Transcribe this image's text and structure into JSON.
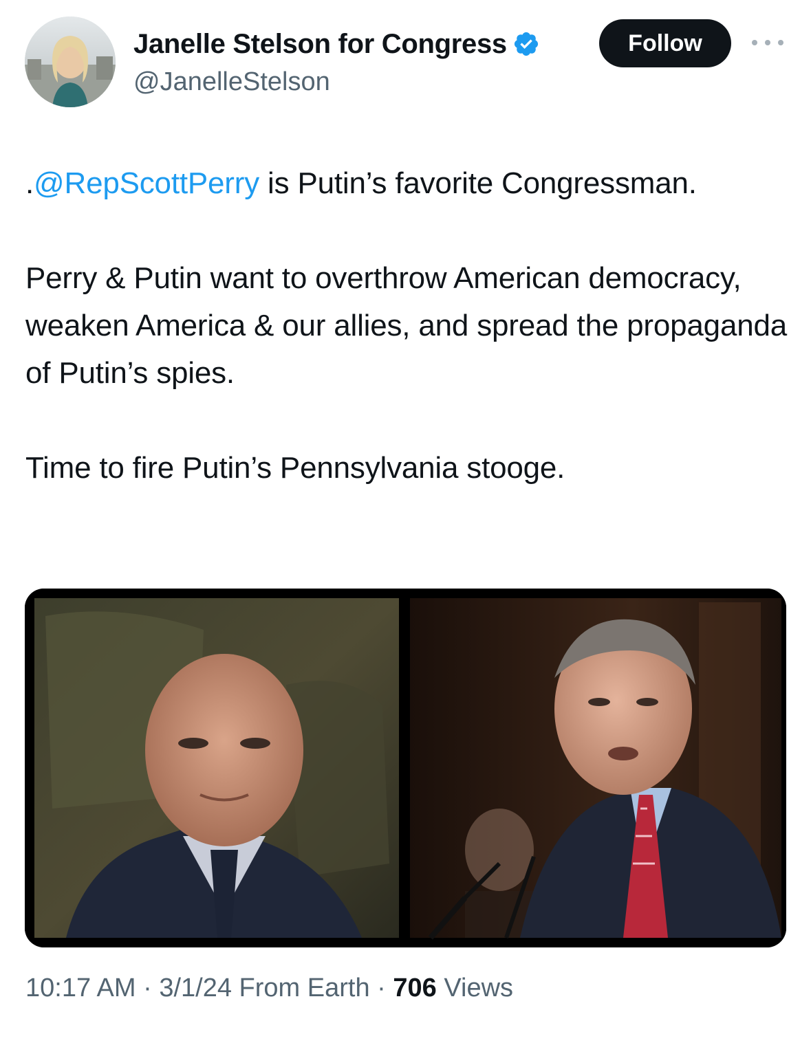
{
  "author": {
    "display_name": "Janelle Stelson for Congress",
    "handle": "@JanelleStelson",
    "verified": true,
    "verified_icon": "verified-badge-icon",
    "avatar_icon": "avatar"
  },
  "actions": {
    "follow_label": "Follow",
    "more_icon": "more-horizontal-icon"
  },
  "tweet": {
    "mention_prefix": ".",
    "mention": "@RepScottPerry",
    "line1_rest": " is Putin’s favorite Congressman.",
    "para2": "Perry & Putin want to overthrow American democracy, weaken America & our allies, and spread the propaganda of Putin’s spies.",
    "para3": "Time to fire Putin’s Pennsylvania stooge."
  },
  "meta": {
    "time": "10:17 AM",
    "sep1": " · ",
    "date": "3/1/24",
    "source": " From Earth",
    "sep2": " · ",
    "views_count": "706",
    "views_label": " Views"
  },
  "colors": {
    "link": "#1d9bf0",
    "text": "#0f1419",
    "secondary": "#536471",
    "follow_bg": "#0f1419",
    "verified": "#1d9bf0"
  }
}
